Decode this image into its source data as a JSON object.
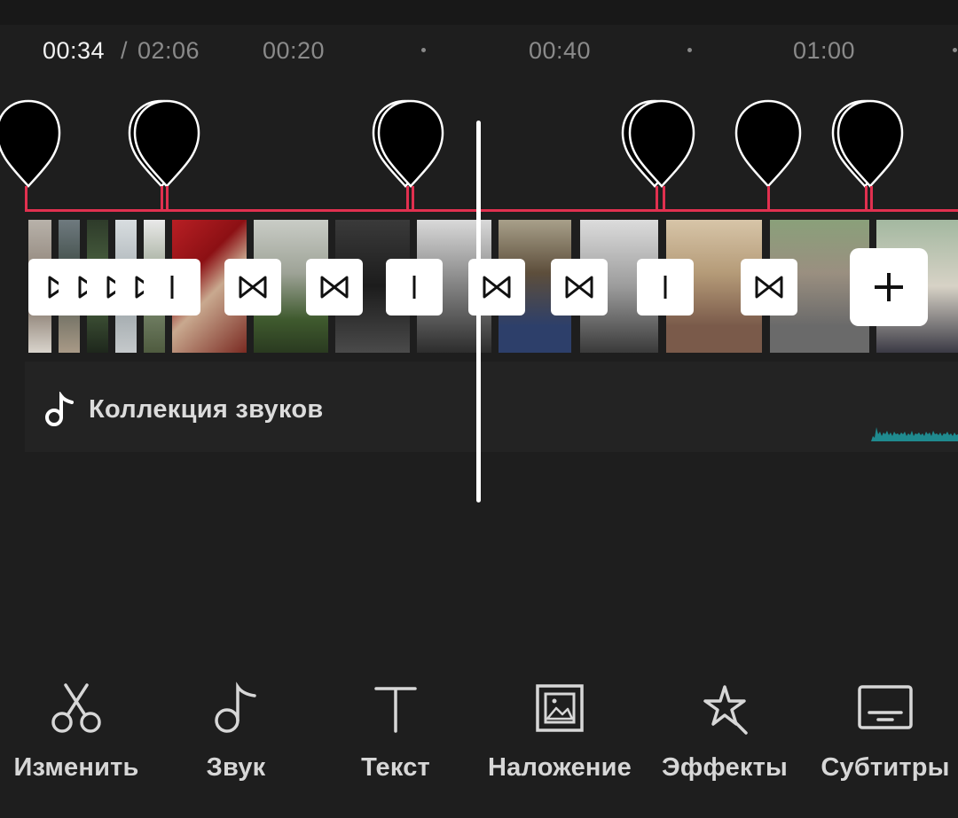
{
  "timeline": {
    "current_time": "00:34",
    "separator": "/",
    "total_time": "02:06",
    "ticks": [
      "00:20",
      "00:40",
      "01:00"
    ]
  },
  "audio_track": {
    "label": "Коллекция звуков",
    "icon": "music-note-icon"
  },
  "toolbar": {
    "items": [
      {
        "label": "Изменить",
        "icon": "scissors-icon"
      },
      {
        "label": "Звук",
        "icon": "music-note-icon"
      },
      {
        "label": "Текст",
        "icon": "text-icon"
      },
      {
        "label": "Наложение",
        "icon": "overlay-image-icon"
      },
      {
        "label": "Эффекты",
        "icon": "effects-star-icon"
      },
      {
        "label": "Субтитры",
        "icon": "subtitles-icon"
      }
    ]
  },
  "colors": {
    "background": "#1e1e1e",
    "beat_line": "#e1304f",
    "waveform": "#1f8a8f",
    "playhead": "#ffffff"
  }
}
